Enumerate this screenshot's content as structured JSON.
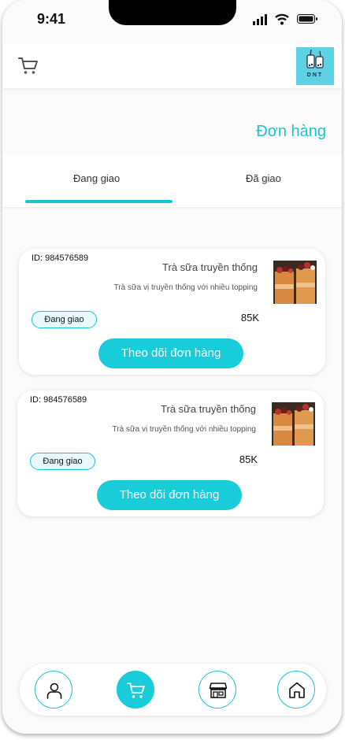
{
  "status_bar": {
    "time": "9:41"
  },
  "header": {
    "logo_text": "DNT"
  },
  "page": {
    "title": "Đơn hàng"
  },
  "tabs": [
    {
      "label": "Đang giao",
      "active": true
    },
    {
      "label": "Đã giao",
      "active": false
    }
  ],
  "orders": [
    {
      "id": "ID: 984576589",
      "name": "Trà sữa truyền thống",
      "description": "Trà sữa vị truyền thống với nhiều topping",
      "price": "85K",
      "status": "Đang giao",
      "button_label": "Theo dõi đơn hàng"
    },
    {
      "id": "ID: 984576589",
      "name": "Trà sữa truyền thống",
      "description": "Trà sữa vị truyền thống với nhiều topping",
      "price": "85K",
      "status": "Đang giao",
      "button_label": "Theo dõi đơn hàng"
    }
  ],
  "bottom_nav": [
    {
      "icon": "user-icon",
      "active": false
    },
    {
      "icon": "cart-icon",
      "active": true
    },
    {
      "icon": "store-icon",
      "active": false
    },
    {
      "icon": "home-icon",
      "active": false
    }
  ],
  "colors": {
    "accent": "#19c4d6",
    "button": "#19ccda",
    "logo_bg": "#5ed1e2"
  }
}
